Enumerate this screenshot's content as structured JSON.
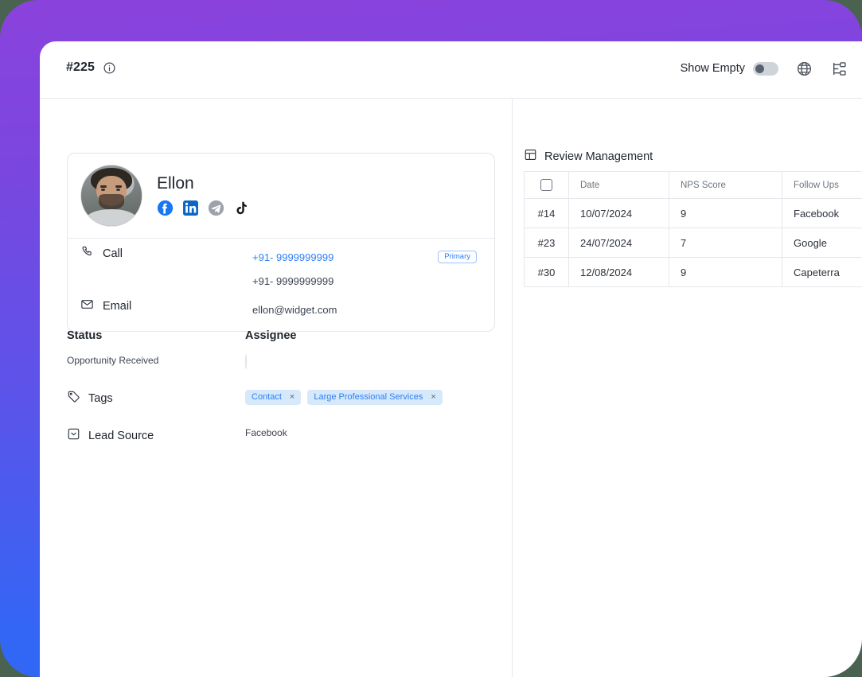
{
  "theme": {
    "gradient_from": "#8b42dc",
    "gradient_to": "#3366f5",
    "page_background": "#4a6350",
    "accent_blue": "#2d7ff9",
    "chip_background": "#d6e9fb",
    "text_primary": "#21262e",
    "text_muted": "#6e7681",
    "border": "#e4e7eb"
  },
  "topbar": {
    "record_id": "#225",
    "info_icon": "info-circle-icon",
    "show_empty_label": "Show Empty",
    "show_empty_state": "off",
    "globe_icon": "globe-icon",
    "hierarchy_icon": "org-hierarchy-icon"
  },
  "contact": {
    "name": "Ellon",
    "avatar_icon": "profile-photo",
    "socials": [
      {
        "name": "facebook-icon",
        "label": "Facebook",
        "color": "#1877f2",
        "enabled": true
      },
      {
        "name": "linkedin-icon",
        "label": "LinkedIn",
        "color": "#0a66c2",
        "enabled": true
      },
      {
        "name": "telegram-icon",
        "label": "Telegram",
        "color": "#9ca3ac",
        "enabled": false
      },
      {
        "name": "tiktok-icon",
        "label": "TikTok",
        "color": "#16181c",
        "enabled": true
      }
    ],
    "call": {
      "label": "Call",
      "icon": "phone-icon",
      "numbers": [
        {
          "value": "+91- 9999999999",
          "badge": "Primary",
          "is_primary": true
        },
        {
          "value": "+91- 9999999999",
          "badge": "",
          "is_primary": false
        }
      ]
    },
    "email": {
      "label": "Email",
      "icon": "envelope-icon",
      "value": "ellon@widget.com"
    }
  },
  "fields": {
    "status_label": "Status",
    "status_value": "Opportunity Received",
    "assignee_label": "Assignee",
    "assignee_avatar_icon": "assignee-photo",
    "tags_label": "Tags",
    "tags_icon": "tag-icon",
    "tags": [
      {
        "label": "Contact",
        "remove": "×"
      },
      {
        "label": "Large Professional Services",
        "remove": "×"
      }
    ],
    "lead_source_label": "Lead Source",
    "lead_source_icon": "dropdown-box-icon",
    "lead_source_value": "Facebook"
  },
  "review_management": {
    "title": "Review Management",
    "icon": "table-layout-icon",
    "columns": [
      "",
      "Date",
      "NPS Score",
      "Follow Ups"
    ],
    "select_all_checked": false,
    "rows": [
      {
        "id": "#14",
        "date": "10/07/2024",
        "nps": "9",
        "follow_up": "Facebook"
      },
      {
        "id": "#23",
        "date": "24/07/2024",
        "nps": "7",
        "follow_up": "Google"
      },
      {
        "id": "#30",
        "date": "12/08/2024",
        "nps": "9",
        "follow_up": "Capeterra"
      }
    ]
  }
}
